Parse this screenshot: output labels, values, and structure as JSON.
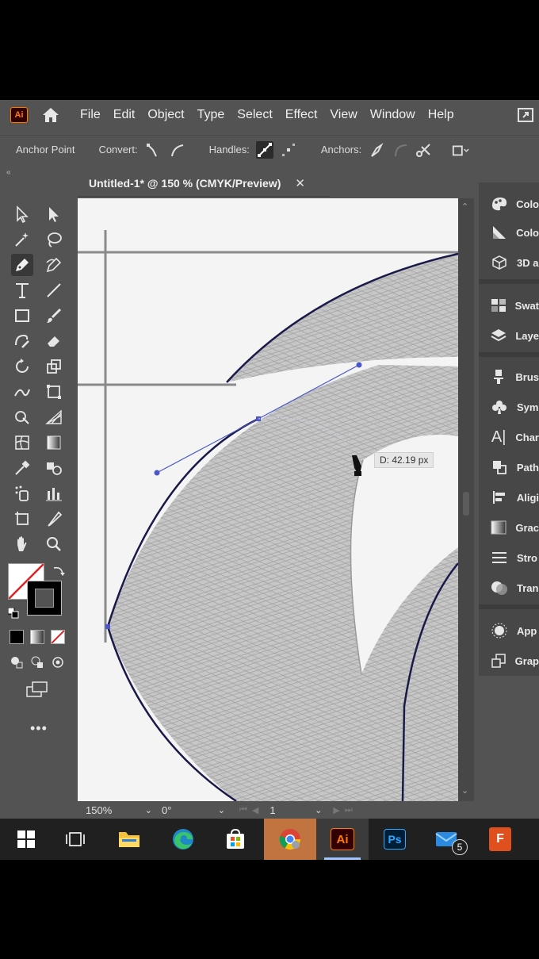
{
  "menubar": {
    "app_logo": "Ai",
    "items": [
      "File",
      "Edit",
      "Object",
      "Type",
      "Select",
      "Effect",
      "View",
      "Window",
      "Help"
    ]
  },
  "controlbar": {
    "anchor_point": "Anchor Point",
    "convert": "Convert:",
    "handles": "Handles:",
    "anchors": "Anchors:"
  },
  "document": {
    "tab_title": "Untitled-1* @ 150 % (CMYK/Preview)",
    "close": "✕"
  },
  "canvas": {
    "measure_readout": "D: 42.19 px"
  },
  "statusbar": {
    "zoom": "150%",
    "rotation": "0°",
    "artboard_number": "1"
  },
  "rightpanel": {
    "items": [
      "Colo",
      "Colo",
      "3D a",
      "Swat",
      "Laye",
      "Brus",
      "Sym",
      "Char",
      "Path",
      "Aligi",
      "Grac",
      "Stro",
      "Tran",
      "App",
      "Grap"
    ]
  },
  "taskbar": {
    "illustrator_label": "Ai",
    "photoshop_label": "Ps",
    "mail_badge": "5",
    "f_app_label": "F"
  },
  "colors": {
    "ui_background": "#535353",
    "panel_dark": "#474747",
    "artboard": "#f4f4f4",
    "illustrator_orange": "#ff7c00",
    "photoshop_blue": "#31a8ff",
    "path_selection": "#4a56c9"
  }
}
